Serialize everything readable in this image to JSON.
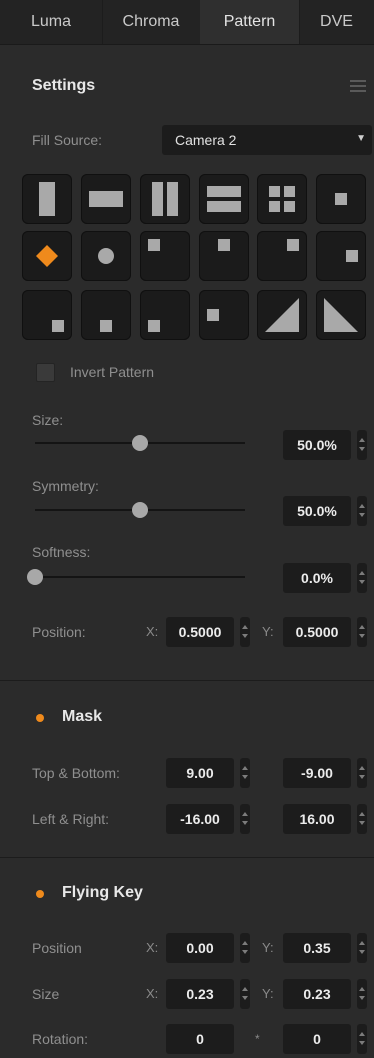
{
  "tabs": [
    "Luma",
    "Chroma",
    "Pattern",
    "DVE"
  ],
  "active_tab": "Pattern",
  "settings": {
    "title": "Settings",
    "fill_source_label": "Fill Source:",
    "fill_source_value": "Camera 2",
    "invert_label": "Invert Pattern",
    "invert_checked": false,
    "selected_pattern_index": 6,
    "size_label": "Size:",
    "size_value": "50.0%",
    "size_level": 0.5,
    "symmetry_label": "Symmetry:",
    "symmetry_value": "50.0%",
    "symmetry_level": 0.5,
    "softness_label": "Softness:",
    "softness_value": "0.0%",
    "softness_level": 0.0,
    "position_label": "Position:",
    "x_label": "X:",
    "y_label": "Y:",
    "position_x": "0.5000",
    "position_y": "0.5000"
  },
  "patterns": [
    "vertical-bar-icon",
    "horizontal-bar-icon",
    "vertical-barn-door-icon",
    "horizontal-barn-door-icon",
    "four-box-icon",
    "center-box-icon",
    "diamond-iris-icon",
    "circle-iris-icon",
    "top-left-box-icon",
    "top-center-box-icon",
    "top-right-box-icon",
    "right-center-box-icon",
    "bottom-right-box-icon",
    "bottom-center-box-icon",
    "bottom-left-box-icon",
    "left-center-box-icon",
    "top-left-diagonal-icon",
    "top-right-diagonal-icon"
  ],
  "mask": {
    "title": "Mask",
    "top_bottom_label": "Top & Bottom:",
    "top": "9.00",
    "bottom": "-9.00",
    "left_right_label": "Left & Right:",
    "left": "-16.00",
    "right": "16.00"
  },
  "flying_key": {
    "title": "Flying Key",
    "position_label": "Position",
    "size_label": "Size",
    "rotation_label": "Rotation:",
    "x_label": "X:",
    "y_label": "Y:",
    "pos_x": "0.00",
    "pos_y": "0.35",
    "size_x": "0.23",
    "size_y": "0.23",
    "rot_a": "0",
    "rot_b": "0",
    "rot_separator": "*"
  },
  "colors": {
    "accent": "#ef8a1c",
    "panel": "#2b2b2b",
    "field": "#1c1c1c"
  }
}
